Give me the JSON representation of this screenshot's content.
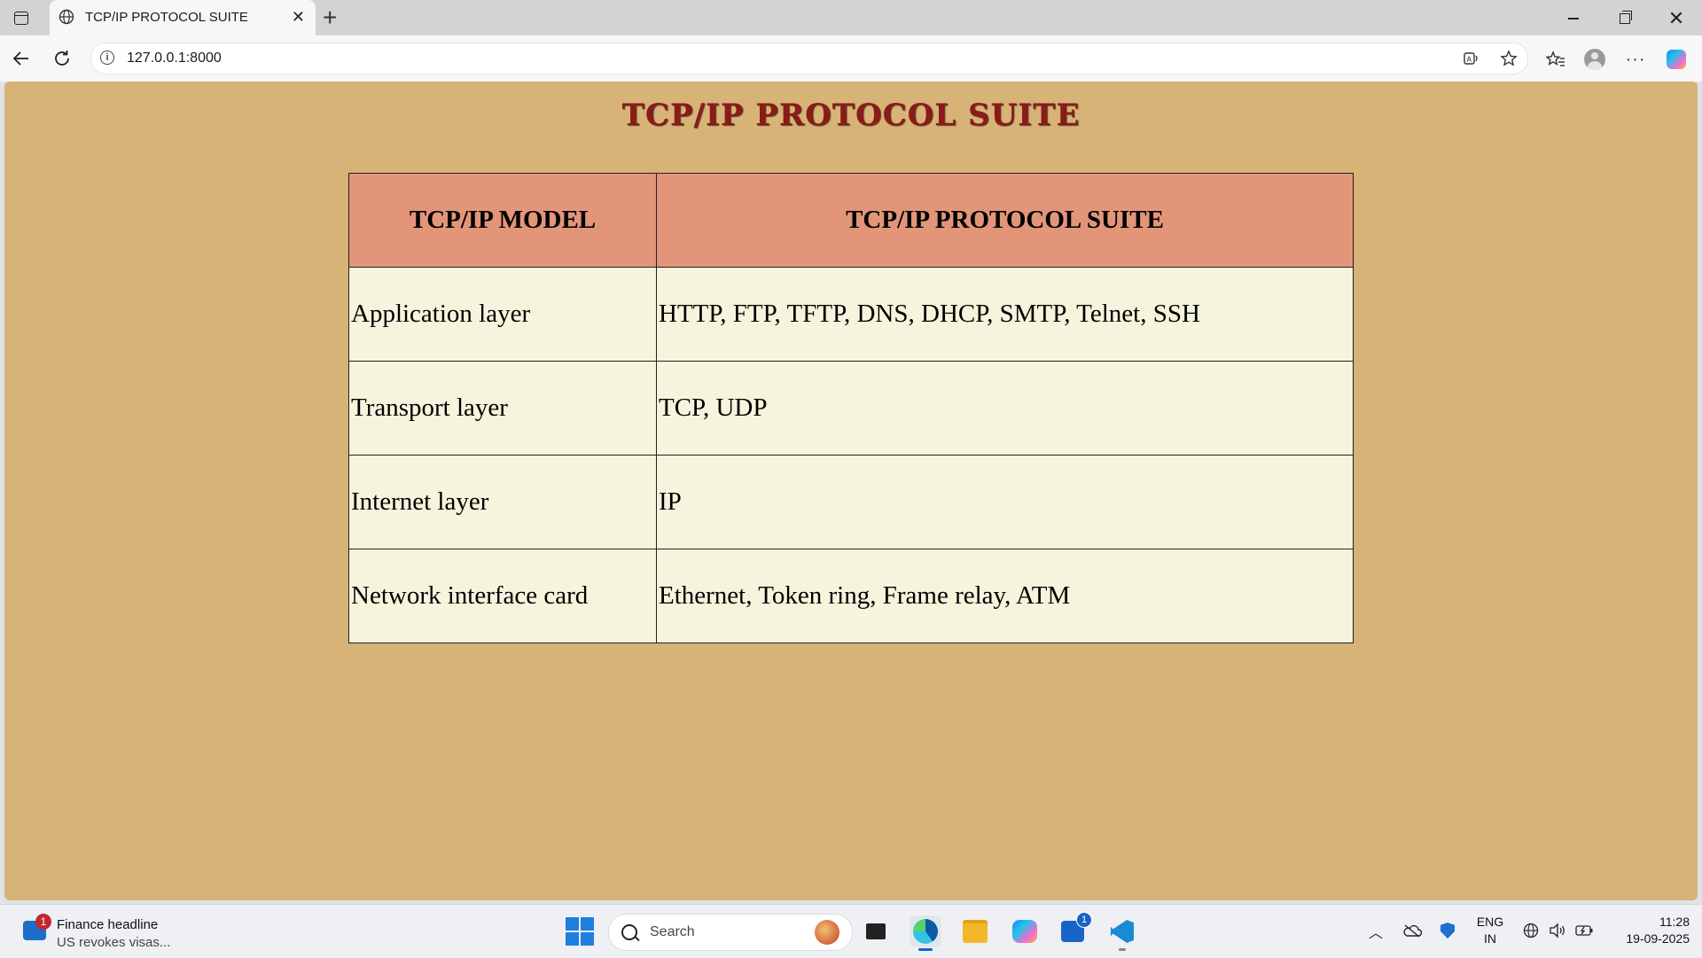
{
  "browser": {
    "tab_title": "TCP/IP PROTOCOL SUITE",
    "url": "127.0.0.1:8000",
    "new_tab_symbol": "+",
    "close_tab_symbol": "✕"
  },
  "page": {
    "heading": "TCP/IP PROTOCOL SUITE",
    "table": {
      "headers": [
        "TCP/IP MODEL",
        "TCP/IP PROTOCOL SUITE"
      ],
      "rows": [
        [
          "Application layer",
          "HTTP, FTP, TFTP, DNS, DHCP, SMTP, Telnet, SSH"
        ],
        [
          "Transport layer",
          "TCP, UDP"
        ],
        [
          "Internet layer",
          "IP"
        ],
        [
          "Network interface card",
          "Ethernet, Token ring, Frame relay, ATM"
        ]
      ]
    },
    "colors": {
      "background": "#d7b377",
      "heading": "#8b1a1a",
      "header_cell": "#e3957a",
      "body_cell": "#f5f5dd"
    }
  },
  "taskbar": {
    "widget_badge": "1",
    "widget_title": "Finance headline",
    "widget_subtitle": "US revokes visas...",
    "search_label": "Search",
    "store_badge": "1",
    "lang_line1": "ENG",
    "lang_line2": "IN",
    "time": "11:28",
    "date": "19-09-2025"
  },
  "icons": [
    "sidebar-icon",
    "globe-icon",
    "back-arrow-icon",
    "reload-icon",
    "info-icon",
    "read-aloud-icon",
    "star-icon",
    "favorites-icon",
    "profile-icon",
    "more-icon",
    "copilot-icon",
    "windows-start-icon",
    "search-icon",
    "task-view-icon",
    "edge-icon",
    "file-explorer-icon",
    "store-icon",
    "vscode-icon",
    "onedrive-icon",
    "defender-icon",
    "network-icon",
    "volume-icon",
    "battery-icon"
  ]
}
